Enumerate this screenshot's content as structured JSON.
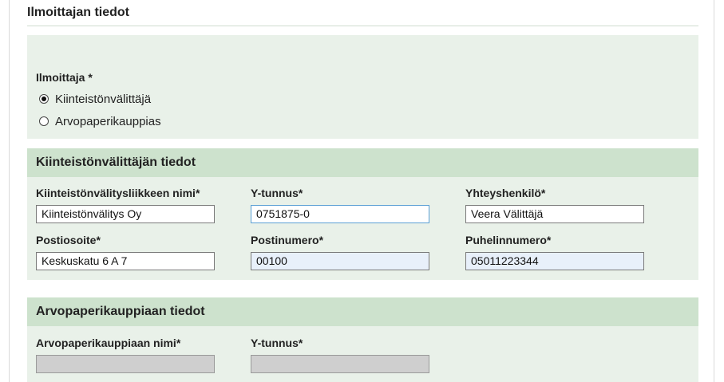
{
  "page_title": "Ilmoittajan tiedot",
  "ilmoittaja": {
    "label": "Ilmoittaja *",
    "options": [
      {
        "label": "Kiinteistönvälittäjä",
        "checked": true
      },
      {
        "label": "Arvopaperikauppias",
        "checked": false
      }
    ]
  },
  "kv_section": {
    "title": "Kiinteistönvälittäjän tiedot",
    "fields": {
      "name": {
        "label": "Kiinteistönvälitysliikkeen nimi*",
        "value": "Kiinteistönvälitys Oy"
      },
      "ytunnus": {
        "label": "Y-tunnus*",
        "value": "0751875-0"
      },
      "contact": {
        "label": "Yhteyshenkilö*",
        "value": "Veera Välittäjä"
      },
      "address": {
        "label": "Postiosoite*",
        "value": "Keskuskatu 6 A 7"
      },
      "postal": {
        "label": "Postinumero*",
        "value": "00100"
      },
      "phone": {
        "label": "Puhelinnumero*",
        "value": "05011223344"
      }
    }
  },
  "ap_section": {
    "title": "Arvopaperikauppiaan tiedot",
    "fields": {
      "name": {
        "label": "Arvopaperikauppiaan nimi*",
        "value": ""
      },
      "ytunnus": {
        "label": "Y-tunnus*",
        "value": ""
      }
    }
  }
}
